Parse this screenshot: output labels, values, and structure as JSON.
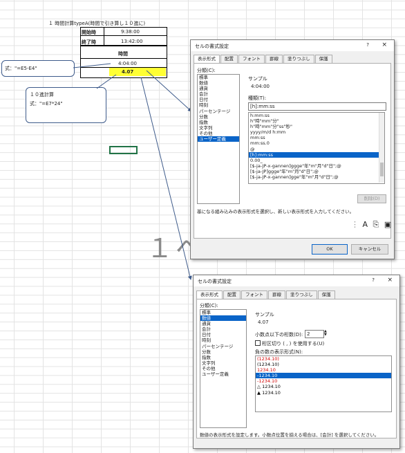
{
  "sheet": {
    "title": "１ 時間計算typeA(時間で引き算し１０進に)",
    "start_label": "開始時",
    "start_value": "9:38:00",
    "end_label": "終了時",
    "end_value": "13:42:00",
    "duration_label": "時間",
    "duration_value": "4:04:00",
    "decimal_value": "4.07",
    "big_text": "１へ",
    "callout1_text": "式：\"=E5-E4\"",
    "callout2_line1": "１０進計算",
    "callout2_line2": "式：\"=E7*24\""
  },
  "dialog1": {
    "title": "セルの書式設定",
    "help": "?",
    "close": "×",
    "tabs": [
      "表示形式",
      "配置",
      "フォント",
      "罫線",
      "塗りつぶし",
      "保護"
    ],
    "category_label": "分類(C):",
    "categories": [
      "標準",
      "数値",
      "通貨",
      "会計",
      "日付",
      "時刻",
      "パーセンテージ",
      "分数",
      "指数",
      "文字列",
      "その他",
      "ユーザー定義"
    ],
    "selected_category_index": 11,
    "sample_label": "サンプル",
    "sample_value": "4:04:00",
    "type_label": "種類(T):",
    "type_value": "[h]:mm:ss",
    "formats": [
      "h:mm:ss",
      "h\"時\"mm\"分\"",
      "h\"時\"mm\"分\"ss\"秒\"",
      "yyyy/m/d h:mm",
      "mm:ss",
      "mm:ss.0",
      "@",
      "[h]:mm:ss",
      "0.00_",
      "[$-ja-JP-x-gannen]ggge\"年\"m\"月\"d\"日\";@",
      "[$-ja-JP]ggge\"年\"m\"月\"d\"日\";@",
      "[$-ja-JP-x-gannen]gge\"年\"m\"月\"d\"日\";@"
    ],
    "selected_format_index": 7,
    "delete_label": "削除(D)",
    "description": "基になる組み込みの表示形式を選択し、新しい表示形式を入力してください。",
    "ok_label": "OK",
    "cancel_label": "キャンセル"
  },
  "dialog2": {
    "title": "セルの書式設定",
    "help": "?",
    "close": "×",
    "tabs": [
      "表示形式",
      "配置",
      "フォント",
      "罫線",
      "塗りつぶし",
      "保護"
    ],
    "category_label": "分類(C):",
    "categories": [
      "標準",
      "数値",
      "通貨",
      "会計",
      "日付",
      "時刻",
      "パーセンテージ",
      "分数",
      "指数",
      "文字列",
      "その他",
      "ユーザー定義"
    ],
    "selected_category_index": 1,
    "sample_label": "サンプル",
    "sample_value": "4.07",
    "decimals_label": "小数点以下の桁数(D):",
    "decimals_value": "2",
    "thousands_label": "桁区切り ( , ) を使用する(U)",
    "negative_label": "負の数の表示形式(N):",
    "negatives": [
      "(1234.10)",
      "(1234.10)",
      "1234.10",
      "-1234.10",
      "-1234.10",
      "△ 1234.10",
      "▲ 1234.10"
    ],
    "negative_colors": [
      "#d00000",
      "#000000",
      "#d00000",
      "#ffffff",
      "#d00000",
      "#000000",
      "#000000"
    ],
    "selected_negative_index": 3,
    "description": "数値の表示形式を設定します。小数点位置を揃える場合は、[会計] を選択してください。"
  },
  "colors": {
    "highlight": "#ffff33",
    "accent": "#0a64c8",
    "arrow": "#3d5a8a"
  }
}
